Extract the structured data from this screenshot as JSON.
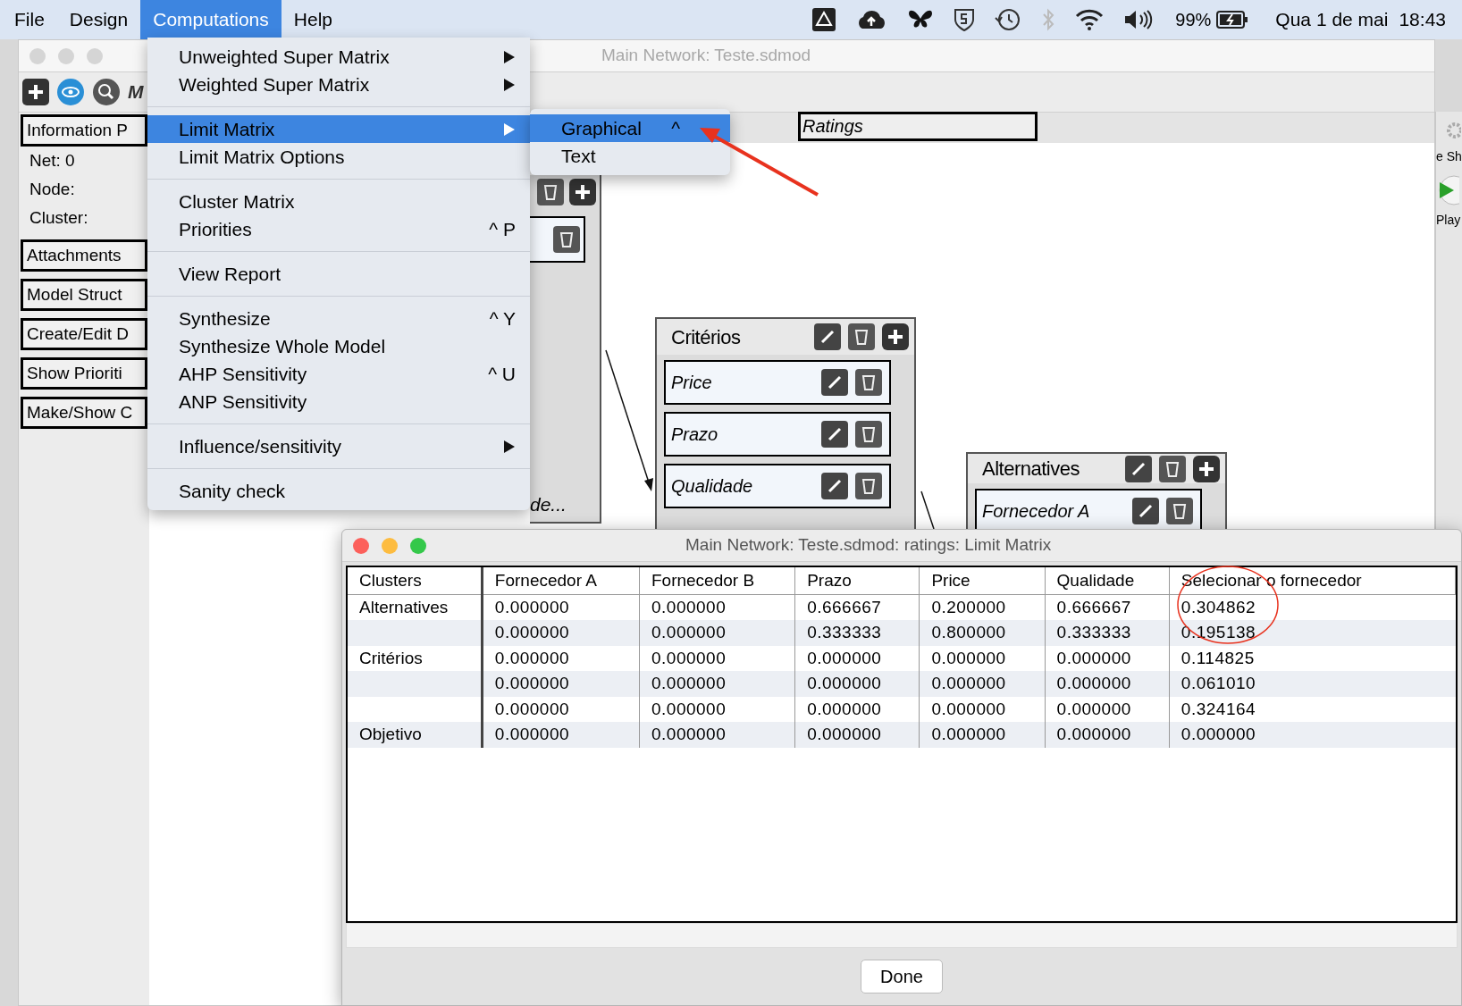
{
  "menubar": {
    "menus": [
      {
        "label": "File",
        "selected": false
      },
      {
        "label": "Design",
        "selected": false
      },
      {
        "label": "Computations",
        "selected": true
      },
      {
        "label": "Help",
        "selected": false
      }
    ],
    "battery": "99%",
    "date": "Qua 1 de mai",
    "time": "18:43"
  },
  "main_window": {
    "title": "Main Network: Teste.sdmod",
    "toolbar_label": "M",
    "left_panel": [
      {
        "kind": "button",
        "label": "Information P"
      },
      {
        "kind": "text",
        "label": "Net: 0"
      },
      {
        "kind": "text",
        "label": "Node:"
      },
      {
        "kind": "text",
        "label": "Cluster:"
      },
      {
        "kind": "button",
        "label": "Attachments"
      },
      {
        "kind": "button",
        "label": "Model Struct"
      },
      {
        "kind": "button",
        "label": "Create/Edit D"
      },
      {
        "kind": "button",
        "label": "Show Prioriti"
      },
      {
        "kind": "button",
        "label": "Make/Show C"
      }
    ],
    "tab": "Ratings",
    "partial_cluster": {
      "label": "de..."
    },
    "clusters": [
      {
        "name": "Critérios",
        "nodes": [
          "Price",
          "Prazo",
          "Qualidade"
        ]
      },
      {
        "name": "Alternatives",
        "nodes": [
          "Fornecedor A"
        ]
      }
    ],
    "right_panel": {
      "label": "e Sh",
      "play_label": "Play"
    }
  },
  "menu": {
    "sections": [
      [
        {
          "label": "Unweighted Super Matrix",
          "submenu": true,
          "selected": false
        },
        {
          "label": "Weighted Super Matrix",
          "submenu": true,
          "selected": false
        }
      ],
      [
        {
          "label": "Limit Matrix",
          "submenu": true,
          "selected": true
        },
        {
          "label": "Limit Matrix Options",
          "submenu": false,
          "selected": false
        }
      ],
      [
        {
          "label": "Cluster Matrix",
          "submenu": false,
          "selected": false
        },
        {
          "label": "Priorities",
          "shortcut": "^ P",
          "submenu": false,
          "selected": false
        }
      ],
      [
        {
          "label": "View Report",
          "submenu": false,
          "selected": false
        }
      ],
      [
        {
          "label": "Synthesize",
          "shortcut": "^ Y",
          "submenu": false,
          "selected": false
        },
        {
          "label": "Synthesize Whole Model",
          "submenu": false,
          "selected": false
        },
        {
          "label": "AHP Sensitivity",
          "shortcut": "^ U",
          "submenu": false,
          "selected": false
        },
        {
          "label": "ANP Sensitivity",
          "submenu": false,
          "selected": false
        }
      ],
      [
        {
          "label": "Influence/sensitivity",
          "submenu": true,
          "selected": false
        }
      ],
      [
        {
          "label": "Sanity check",
          "submenu": false,
          "selected": false
        }
      ]
    ],
    "submenu": [
      {
        "label": "Graphical",
        "shortcut": "^",
        "selected": true
      },
      {
        "label": "Text",
        "selected": false
      }
    ]
  },
  "dialog": {
    "title": "Main Network: Teste.sdmod: ratings: Limit Matrix",
    "columns": [
      "Clusters",
      "Fornecedor A",
      "Fornecedor B",
      "Prazo",
      "Price",
      "Qualidade",
      "Selecionar o fornecedor"
    ],
    "rows": [
      {
        "cluster": "Alternatives",
        "values": [
          "0.000000",
          "0.000000",
          "0.666667",
          "0.200000",
          "0.666667",
          "0.304862"
        ]
      },
      {
        "values": [
          "0.000000",
          "0.000000",
          "0.333333",
          "0.800000",
          "0.333333",
          "0.195138"
        ]
      },
      {
        "cluster": "Critérios",
        "values": [
          "0.000000",
          "0.000000",
          "0.000000",
          "0.000000",
          "0.000000",
          "0.114825"
        ]
      },
      {
        "values": [
          "0.000000",
          "0.000000",
          "0.000000",
          "0.000000",
          "0.000000",
          "0.061010"
        ]
      },
      {
        "values": [
          "0.000000",
          "0.000000",
          "0.000000",
          "0.000000",
          "0.000000",
          "0.324164"
        ]
      },
      {
        "cluster": "Objetivo",
        "values": [
          "0.000000",
          "0.000000",
          "0.000000",
          "0.000000",
          "0.000000",
          "0.000000"
        ]
      }
    ],
    "button": "Done"
  }
}
